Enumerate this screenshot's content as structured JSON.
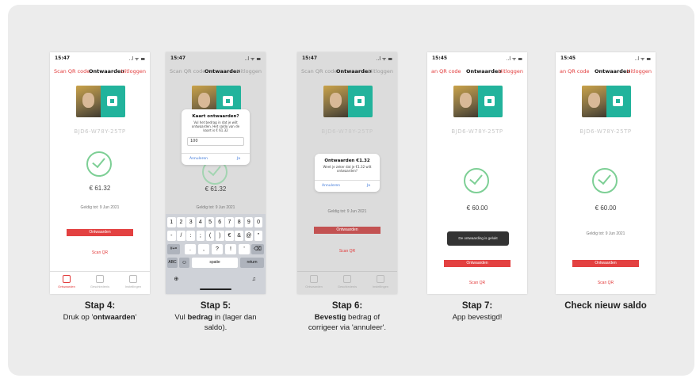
{
  "steps": [
    {
      "heading": "Stap 4:",
      "desc_before": "Druk op '",
      "desc_bold": "ontwaarden",
      "desc_after": "'",
      "phone": {
        "time": "15:47",
        "signal": "..l ᯤ ▬",
        "nav_left": "Scan QR code",
        "nav_center": "Ontwaarden",
        "nav_right": "Uitloggen",
        "code": "BJD6-W78Y-25TP",
        "amount": "€ 61.32",
        "date": "Geldig tot: 9 Jun 2021",
        "button": "Ontwaarden",
        "link": "Scan QR",
        "tabs": [
          "Ontwaarden",
          "Geschiedenis",
          "Instellingen"
        ]
      }
    },
    {
      "heading": "Stap 5:",
      "desc_l1_before": "Vul ",
      "desc_l1_bold": "bedrag",
      "desc_l1_after": " in (lager dan",
      "desc_l2": "saldo).",
      "phone": {
        "time": "15:47",
        "signal": "..l ᯤ ▬",
        "nav_left": "Scan QR code",
        "nav_center": "Ontwaarden",
        "nav_right": "Uitloggen",
        "amount": "€ 61.32",
        "date": "Geldig tot: 9 Jun 2021",
        "dialog_title": "Kaart ontwaarden?",
        "dialog_body": "Vul het bedrag in dat je wilt ontwaarden. Het saldo van de kaart is € 61.32",
        "dialog_input": "100",
        "dialog_cancel": "Annuleren",
        "dialog_ok": "Ja",
        "keys_row1": [
          "1",
          "2",
          "3",
          "4",
          "5",
          "6",
          "7",
          "8",
          "9",
          "0"
        ],
        "keys_row2": [
          "-",
          "/",
          ":",
          ";",
          "(",
          ")",
          "€",
          "&",
          "@",
          "\""
        ],
        "keys_row3": [
          "#+=",
          ".",
          ",",
          "?",
          "!",
          "'",
          "⌫"
        ],
        "key_abc": "ABC",
        "key_emoji": "☺",
        "key_space": "spatie",
        "key_return": "return",
        "key_globe": "⊕",
        "key_mic": "♫"
      }
    },
    {
      "heading": "Stap 6:",
      "desc_l1_bold": "Bevestig",
      "desc_l1_after": " bedrag of",
      "desc_l2": "corrigeer via 'annuleer'.",
      "phone": {
        "time": "15:47",
        "signal": "..l ᯤ ▬",
        "nav_left": "Scan QR code",
        "nav_center": "Ontwaarden",
        "nav_right": "Uitloggen",
        "code": "BJD6-W78Y-25TP",
        "date": "Geldig tot: 9 Jun 2021",
        "dialog_title": "Ontwaarden €1.32",
        "dialog_body": "Weet je zeker dat je €1.32 wilt ontwaarden?",
        "dialog_cancel": "Annuleren",
        "dialog_ok": "Ja",
        "button": "Ontwaarden",
        "link": "Scan QR",
        "tabs": [
          "Ontwaarden",
          "Geschiedenis",
          "Instellingen"
        ]
      }
    },
    {
      "heading": "Stap 7:",
      "desc_l1": "App bevestigd!",
      "phone": {
        "time": "15:45",
        "signal": "..l ᯤ ▬",
        "nav_left": "an QR code",
        "nav_center": "Ontwaarden",
        "nav_right": "Uitloggen",
        "code": "BJD6-W78Y-25TP",
        "amount": "€ 60.00",
        "toast": "De ontwaarding is gelukt",
        "button": "Ontwaarden",
        "link": "Scan QR"
      }
    },
    {
      "heading": "Check nieuw saldo",
      "phone": {
        "time": "15:45",
        "signal": "..l ᯤ ▬",
        "nav_left": "an QR code",
        "nav_center": "Ontwaarden",
        "nav_right": "Uitloggen",
        "code": "BJD6-W78Y-25TP",
        "amount": "€ 60.00",
        "date": "Geldig tot: 9 Jun 2021",
        "button": "Ontwaarden",
        "link": "Scan QR"
      }
    }
  ]
}
